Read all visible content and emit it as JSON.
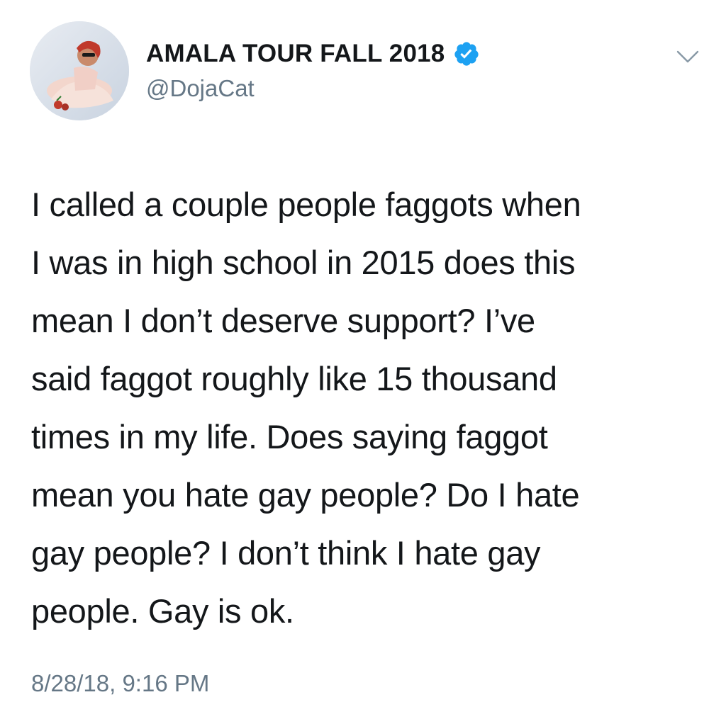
{
  "user": {
    "display_name": "AMALA TOUR FALL 2018",
    "handle": "@DojaCat",
    "verified": true
  },
  "tweet": {
    "lines": [
      "I called a couple people faggots when",
      "I was in high school in 2015 does this",
      "mean I don’t deserve support? I’ve",
      "said faggot roughly like 15 thousand",
      "times in my life. Does saying faggot",
      "mean you hate gay people? Do I hate",
      "gay people? I don’t think I hate gay",
      "people. Gay is ok."
    ],
    "timestamp": "8/28/18, 9:16 PM"
  },
  "icons": {
    "verified": "verified-badge-icon",
    "menu": "chevron-down-icon"
  },
  "colors": {
    "name": "#14171a",
    "secondary": "#657786",
    "verified_blue": "#1da1f2",
    "background": "#ffffff"
  }
}
